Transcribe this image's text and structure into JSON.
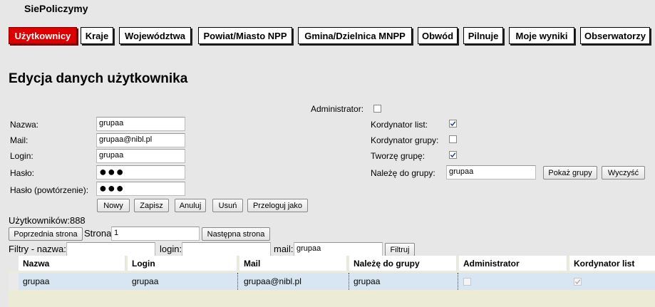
{
  "app": {
    "title": "SiePoliczymy"
  },
  "tabs": [
    {
      "label": "Użytkownicy",
      "active": true
    },
    {
      "label": "Kraje"
    },
    {
      "label": "Województwa"
    },
    {
      "label": "Powiat/Miasto NPP"
    },
    {
      "label": "Gmina/Dzielnica MNPP"
    },
    {
      "label": "Obwód"
    },
    {
      "label": "Pilnuje"
    },
    {
      "label": "Moje wyniki"
    },
    {
      "label": "Obserwatorzy"
    }
  ],
  "page": {
    "title": "Edycja danych użytkownika"
  },
  "form": {
    "administrator": {
      "label": "Administrator:",
      "checked": false
    },
    "nazwa": {
      "label": "Nazwa:",
      "value": "grupaa"
    },
    "mail": {
      "label": "Mail:",
      "value": "grupaa@nibl.pl"
    },
    "login": {
      "label": "Login:",
      "value": "grupaa"
    },
    "haslo": {
      "label": "Hasło:",
      "value": "●●●"
    },
    "haslo2": {
      "label": "Hasło (powtórzenie):",
      "value": "●●●"
    },
    "kordynator_list": {
      "label": "Kordynator list:",
      "checked": true
    },
    "kordynator_grupy": {
      "label": "Kordynator grupy:",
      "checked": false
    },
    "tworze_grupe": {
      "label": "Tworzę grupę:",
      "checked": true
    },
    "naleze_do_grupy": {
      "label": "Należę do grupy:",
      "value": "grupaa"
    },
    "buttons": {
      "pokaz_grupy": "Pokaż grupy",
      "wyczysc": "Wyczyść",
      "nowy": "Nowy",
      "zapisz": "Zapisz",
      "anuluj": "Anuluj",
      "usun": "Usuń",
      "przeloguj": "Przeloguj jako"
    }
  },
  "list": {
    "count_label": "Użytkowników:888",
    "prev_page": "Poprzednia strona",
    "page_label": "Strona",
    "page_value": "1",
    "next_page": "Następna strona"
  },
  "filters": {
    "nazwa_label": "Filtry - nazwa:",
    "nazwa_value": "",
    "login_label": "login:",
    "login_value": "",
    "mail_label": "mail:",
    "mail_value": "grupaa",
    "button": "Filtruj"
  },
  "table": {
    "headers": [
      "Nazwa",
      "Login",
      "Mail",
      "Należę do grupy",
      "Administrator",
      "Kordynator list"
    ],
    "rows": [
      {
        "nazwa": "grupaa",
        "login": "grupaa",
        "mail": "grupaa@nibl.pl",
        "grupa": "grupaa",
        "administrator": false,
        "kordynator_list": true
      }
    ]
  },
  "colors": {
    "active_tab": "#dd0000",
    "background": "#e7e7e7",
    "row_highlight": "#d8e6f4"
  }
}
